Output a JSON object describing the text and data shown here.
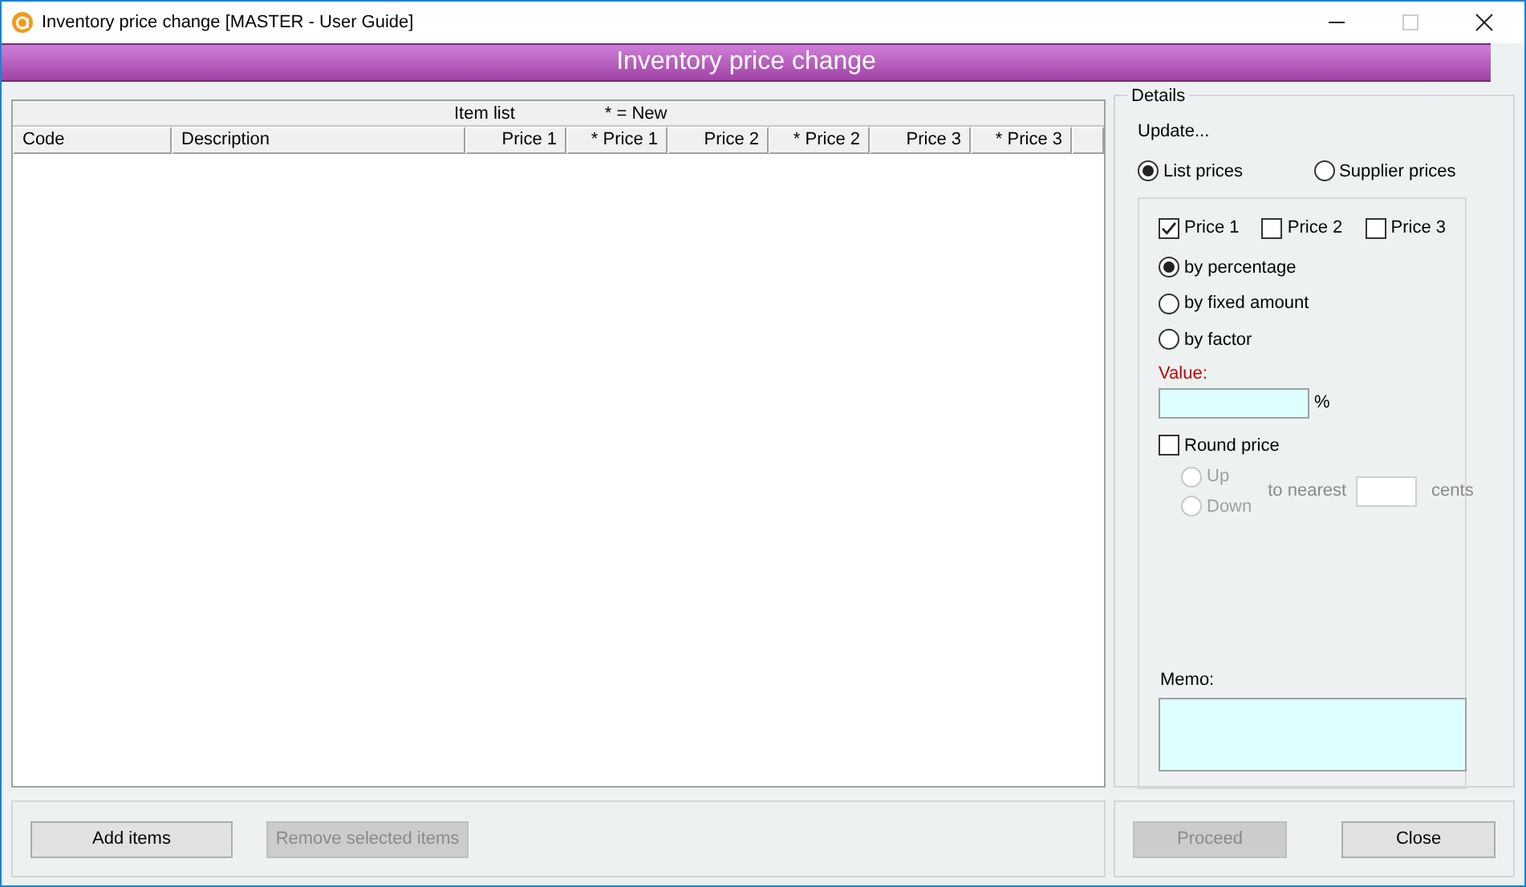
{
  "window": {
    "title": "Inventory price change [MASTER - User Guide]"
  },
  "header": "Inventory price change",
  "table": {
    "caption": "Item list",
    "note": "* = New",
    "columns": [
      "Code",
      "Description",
      "Price 1",
      "* Price 1",
      "Price 2",
      "* Price 2",
      "Price 3",
      "* Price 3"
    ]
  },
  "details": {
    "legend": "Details",
    "update_label": "Update...",
    "sources": [
      {
        "label": "List prices",
        "selected": true
      },
      {
        "label": "Supplier prices",
        "selected": false
      }
    ],
    "prices": [
      {
        "label": "Price 1",
        "checked": true
      },
      {
        "label": "Price 2",
        "checked": false
      },
      {
        "label": "Price 3",
        "checked": false
      }
    ],
    "methods": [
      {
        "label": "by percentage",
        "selected": true
      },
      {
        "label": "by fixed amount",
        "selected": false
      },
      {
        "label": "by factor",
        "selected": false
      }
    ],
    "value_label": "Value:",
    "value_unit": "%",
    "round": {
      "label": "Round price",
      "checked": false
    },
    "directions": [
      {
        "label": "Up",
        "selected": false,
        "disabled": true
      },
      {
        "label": "Down",
        "selected": false,
        "disabled": true
      }
    ],
    "to_nearest": "to nearest",
    "cents": "cents",
    "memo_label": "Memo:"
  },
  "buttons_left": [
    {
      "label": "Add items",
      "disabled": false
    },
    {
      "label": "Remove selected items",
      "disabled": true
    }
  ],
  "buttons_right": [
    {
      "label": "Proceed",
      "disabled": true
    },
    {
      "label": "Close",
      "disabled": false
    }
  ]
}
